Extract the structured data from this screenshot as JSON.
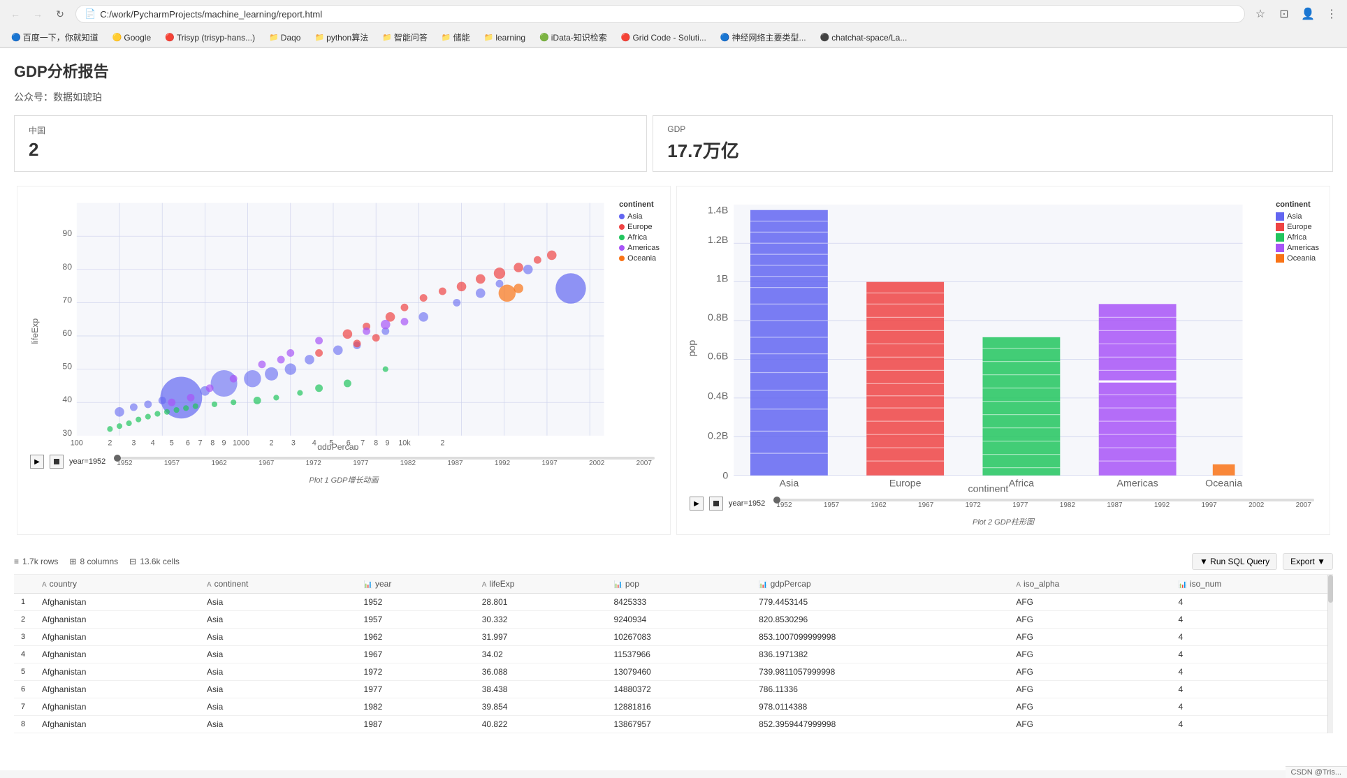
{
  "browser": {
    "address": "C:/work/PycharmProjects/machine_learning/report.html",
    "file_icon": "📄"
  },
  "bookmarks": [
    {
      "label": "百度一下，你就知道",
      "icon": "🔵"
    },
    {
      "label": "Google",
      "icon": "🟡"
    },
    {
      "label": "Trisyp (trisyp-hans...)",
      "icon": "🔴"
    },
    {
      "label": "Daqo",
      "icon": "📁"
    },
    {
      "label": "python算法",
      "icon": "📁"
    },
    {
      "label": "智能问答",
      "icon": "📁"
    },
    {
      "label": "储能",
      "icon": "📁"
    },
    {
      "label": "learning",
      "icon": "📁"
    },
    {
      "label": "iData-知识检索",
      "icon": "🟢"
    },
    {
      "label": "Grid Code - Soluti...",
      "icon": "🔴"
    },
    {
      "label": "神经网络主要类型...",
      "icon": "🔵"
    },
    {
      "label": "chatchat-space/La...",
      "icon": "⚫"
    }
  ],
  "page": {
    "title": "GDP分析报告",
    "subtitle": "公众号：数据如琥珀"
  },
  "metrics": {
    "china_label": "中国",
    "china_value": "2",
    "gdp_label": "GDP",
    "gdp_value": "17.7万亿"
  },
  "chart1": {
    "title": "Plot 1 GDP增长动画",
    "year_label": "year=1952",
    "x_axis": "gdpPercap",
    "y_axis": "lifeExp",
    "legend_title": "continent",
    "legend": [
      {
        "label": "Asia",
        "color": "#6366f1"
      },
      {
        "label": "Europe",
        "color": "#ef4444"
      },
      {
        "label": "Africa",
        "color": "#22c55e"
      },
      {
        "label": "Americas",
        "color": "#a855f7"
      },
      {
        "label": "Oceania",
        "color": "#f97316"
      }
    ],
    "timeline_years": [
      "1952",
      "1957",
      "1962",
      "1967",
      "1972",
      "1977",
      "1982",
      "1987",
      "1992",
      "1997",
      "2002",
      "2007"
    ],
    "y_ticks": [
      "30",
      "40",
      "50",
      "60",
      "70",
      "80",
      "90"
    ],
    "x_ticks_left": [
      "100",
      "2",
      "3",
      "4",
      "5",
      "6",
      "7",
      "8",
      "9",
      "1000"
    ],
    "x_ticks_right": [
      "2",
      "3",
      "4",
      "5",
      "6",
      "7",
      "8",
      "9",
      "10k",
      "2"
    ]
  },
  "chart2": {
    "title": "Plot 2 GDP柱形图",
    "year_label": "year=1952",
    "x_axis": "continent",
    "y_axis": "pop",
    "legend_title": "continent",
    "legend": [
      {
        "label": "Asia",
        "color": "#6366f1"
      },
      {
        "label": "Europe",
        "color": "#ef4444"
      },
      {
        "label": "Africa",
        "color": "#22c55e"
      },
      {
        "label": "Americas",
        "color": "#a855f7"
      },
      {
        "label": "Oceania",
        "color": "#f97316"
      }
    ],
    "timeline_years": [
      "1952",
      "1957",
      "1962",
      "1967",
      "1972",
      "1977",
      "1982",
      "1987",
      "1992",
      "1997",
      "2002",
      "2007"
    ],
    "y_ticks": [
      "0",
      "0.2B",
      "0.4B",
      "0.6B",
      "0.8B",
      "1B",
      "1.2B",
      "1.4B"
    ],
    "x_categories": [
      "Asia",
      "Europe",
      "Africa",
      "Americas",
      "Oceania"
    ],
    "bars": [
      {
        "continent": "Asia",
        "segments": [
          {
            "color": "#6366f1",
            "pct": 100
          }
        ]
      },
      {
        "continent": "Europe",
        "segments": [
          {
            "color": "#ef4444",
            "pct": 100
          }
        ]
      },
      {
        "continent": "Africa",
        "segments": [
          {
            "color": "#22c55e",
            "pct": 100
          }
        ]
      },
      {
        "continent": "Americas",
        "segments": [
          {
            "color": "#a855f7",
            "pct": 100
          }
        ]
      },
      {
        "continent": "Oceania",
        "segments": [
          {
            "color": "#f97316",
            "pct": 100
          }
        ]
      }
    ]
  },
  "table": {
    "stats": [
      {
        "icon": "≡",
        "label": "1.7k rows"
      },
      {
        "icon": "⊞",
        "label": "8 columns"
      },
      {
        "icon": "⊟",
        "label": "13.6k cells"
      }
    ],
    "actions": {
      "sql": "▼ Run SQL Query",
      "export": "Export ▼"
    },
    "columns": [
      {
        "name": "country",
        "type": "A"
      },
      {
        "name": "continent",
        "type": "A"
      },
      {
        "name": "year",
        "type": "📊"
      },
      {
        "name": "lifeExp",
        "type": "A"
      },
      {
        "name": "pop",
        "type": "📊"
      },
      {
        "name": "gdpPercap",
        "type": "📊"
      },
      {
        "name": "iso_alpha",
        "type": "A"
      },
      {
        "name": "iso_num",
        "type": "📊"
      }
    ],
    "rows": [
      {
        "num": "1",
        "country": "Afghanistan",
        "continent": "Asia",
        "year": "1952",
        "lifeExp": "28.801",
        "pop": "8425333",
        "gdpPercap": "779.4453145",
        "iso_alpha": "AFG",
        "iso_num": "4"
      },
      {
        "num": "2",
        "country": "Afghanistan",
        "continent": "Asia",
        "year": "1957",
        "lifeExp": "30.332",
        "pop": "9240934",
        "gdpPercap": "820.8530296",
        "iso_alpha": "AFG",
        "iso_num": "4"
      },
      {
        "num": "3",
        "country": "Afghanistan",
        "continent": "Asia",
        "year": "1962",
        "lifeExp": "31.997",
        "pop": "10267083",
        "gdpPercap": "853.1007099999998",
        "iso_alpha": "AFG",
        "iso_num": "4"
      },
      {
        "num": "4",
        "country": "Afghanistan",
        "continent": "Asia",
        "year": "1967",
        "lifeExp": "34.02",
        "pop": "11537966",
        "gdpPercap": "836.1971382",
        "iso_alpha": "AFG",
        "iso_num": "4"
      },
      {
        "num": "5",
        "country": "Afghanistan",
        "continent": "Asia",
        "year": "1972",
        "lifeExp": "36.088",
        "pop": "13079460",
        "gdpPercap": "739.9811057999998",
        "iso_alpha": "AFG",
        "iso_num": "4"
      },
      {
        "num": "6",
        "country": "Afghanistan",
        "continent": "Asia",
        "year": "1977",
        "lifeExp": "38.438",
        "pop": "14880372",
        "gdpPercap": "786.11336",
        "iso_alpha": "AFG",
        "iso_num": "4"
      },
      {
        "num": "7",
        "country": "Afghanistan",
        "continent": "Asia",
        "year": "1982",
        "lifeExp": "39.854",
        "pop": "12881816",
        "gdpPercap": "978.0114388",
        "iso_alpha": "AFG",
        "iso_num": "4"
      },
      {
        "num": "8",
        "country": "Afghanistan",
        "continent": "Asia",
        "year": "1987",
        "lifeExp": "40.822",
        "pop": "13867957",
        "gdpPercap": "852.3959447999998",
        "iso_alpha": "AFG",
        "iso_num": "4"
      }
    ]
  },
  "footer": {
    "text": "CSDN @Tris..."
  }
}
